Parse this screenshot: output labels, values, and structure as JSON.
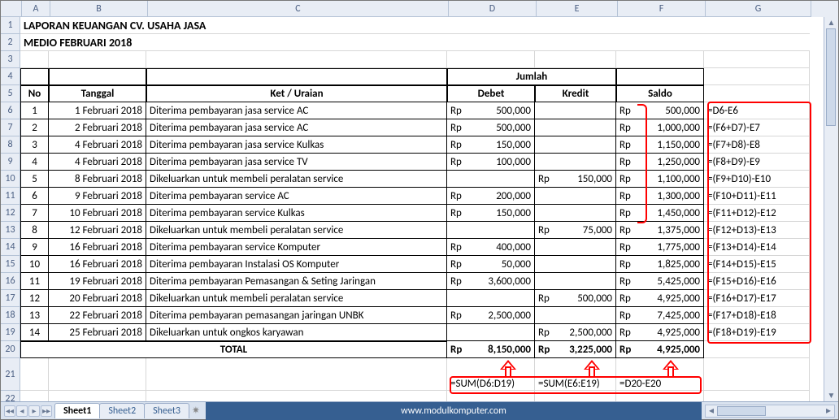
{
  "columns": [
    "A",
    "B",
    "C",
    "D",
    "E",
    "F",
    "G"
  ],
  "titles": {
    "l1": "LAPORAN KEUANGAN CV. USAHA JASA",
    "l2": "MEDIO FEBRUARI 2018"
  },
  "headers": {
    "no": "No",
    "tanggal": "Tanggal",
    "ket": "Ket / Uraian",
    "jumlah": "Jumlah",
    "debet": "Debet",
    "kredit": "Kredit",
    "saldo": "Saldo",
    "total": "TOTAL"
  },
  "currency": "Rp",
  "rows": [
    {
      "no": "1",
      "tgl": "1 Februari 2018",
      "ket": "Diterima pembayaran jasa service AC",
      "debet": "500,000",
      "kredit": "",
      "saldo": "500,000",
      "f": "=D6-E6"
    },
    {
      "no": "2",
      "tgl": "2 Februari 2018",
      "ket": "Diterima pembayaran jasa service AC",
      "debet": "500,000",
      "kredit": "",
      "saldo": "1,000,000",
      "f": "=(F6+D7)-E7"
    },
    {
      "no": "3",
      "tgl": "4 Februari 2018",
      "ket": "Diterima pembayaran jasa service Kulkas",
      "debet": "150,000",
      "kredit": "",
      "saldo": "1,150,000",
      "f": "=(F7+D8)-E8"
    },
    {
      "no": "4",
      "tgl": "4 Februari 2018",
      "ket": "Diterima pembayaran jasa service TV",
      "debet": "100,000",
      "kredit": "",
      "saldo": "1,250,000",
      "f": "=(F8+D9)-E9"
    },
    {
      "no": "5",
      "tgl": "8 Februari 2018",
      "ket": "Dikeluarkan untuk membeli peralatan service",
      "debet": "",
      "kredit": "150,000",
      "saldo": "1,100,000",
      "f": "=(F9+D10)-E10"
    },
    {
      "no": "6",
      "tgl": "9 Februari 2018",
      "ket": "Diterima pembayaran service AC",
      "debet": "200,000",
      "kredit": "",
      "saldo": "1,300,000",
      "f": "=(F10+D11)-E11"
    },
    {
      "no": "7",
      "tgl": "10 Februari 2018",
      "ket": "Diterima pembayaran service Kulkas",
      "debet": "150,000",
      "kredit": "",
      "saldo": "1,450,000",
      "f": "=(F11+D12)-E12"
    },
    {
      "no": "8",
      "tgl": "12 Februari 2018",
      "ket": "Dikeluarkan untuk membeli peralatan service",
      "debet": "",
      "kredit": "75,000",
      "saldo": "1,375,000",
      "f": "=(F12+D13)-E13"
    },
    {
      "no": "9",
      "tgl": "16 Februari 2018",
      "ket": "Diterima pembayaran service Komputer",
      "debet": "400,000",
      "kredit": "",
      "saldo": "1,775,000",
      "f": "=(F13+D14)-E14"
    },
    {
      "no": "10",
      "tgl": "16 Februari 2018",
      "ket": "Diterima pembayaran Instalasi OS Komputer",
      "debet": "50,000",
      "kredit": "",
      "saldo": "1,825,000",
      "f": "=(F14+D15)-E15"
    },
    {
      "no": "11",
      "tgl": "19 Februari 2018",
      "ket": "Diterima pembayaran Pemasangan & Seting Jaringan",
      "debet": "3,600,000",
      "kredit": "",
      "saldo": "5,425,000",
      "f": "=(F15+D16)-E16"
    },
    {
      "no": "12",
      "tgl": "20 Februari 2018",
      "ket": "Dikeluarkan untuk membeli peralatan service",
      "debet": "",
      "kredit": "500,000",
      "saldo": "4,925,000",
      "f": "=(F16+D17)-E17"
    },
    {
      "no": "13",
      "tgl": "22 Februari 2018",
      "ket": "Diterima pembayaran pemasangan jaringan UNBK",
      "debet": "2,500,000",
      "kredit": "",
      "saldo": "7,425,000",
      "f": "=(F17+D18)-E18"
    },
    {
      "no": "14",
      "tgl": "25 Februari 2018",
      "ket": "Dikeluarkan untuk ongkos karyawan",
      "debet": "",
      "kredit": "2,500,000",
      "saldo": "4,925,000",
      "f": "=(F18+D19)-E19"
    }
  ],
  "totals": {
    "debet": "8,150,000",
    "kredit": "3,225,000",
    "saldo": "4,925,000"
  },
  "r21": {
    "d": "=SUM(D6:D19)",
    "e": "=SUM(E6:E19)",
    "f": "=D20-E20"
  },
  "tabs": {
    "active": "Sheet1",
    "others": [
      "Sheet2",
      "Sheet3"
    ],
    "url": "www.modulkomputer.com"
  }
}
